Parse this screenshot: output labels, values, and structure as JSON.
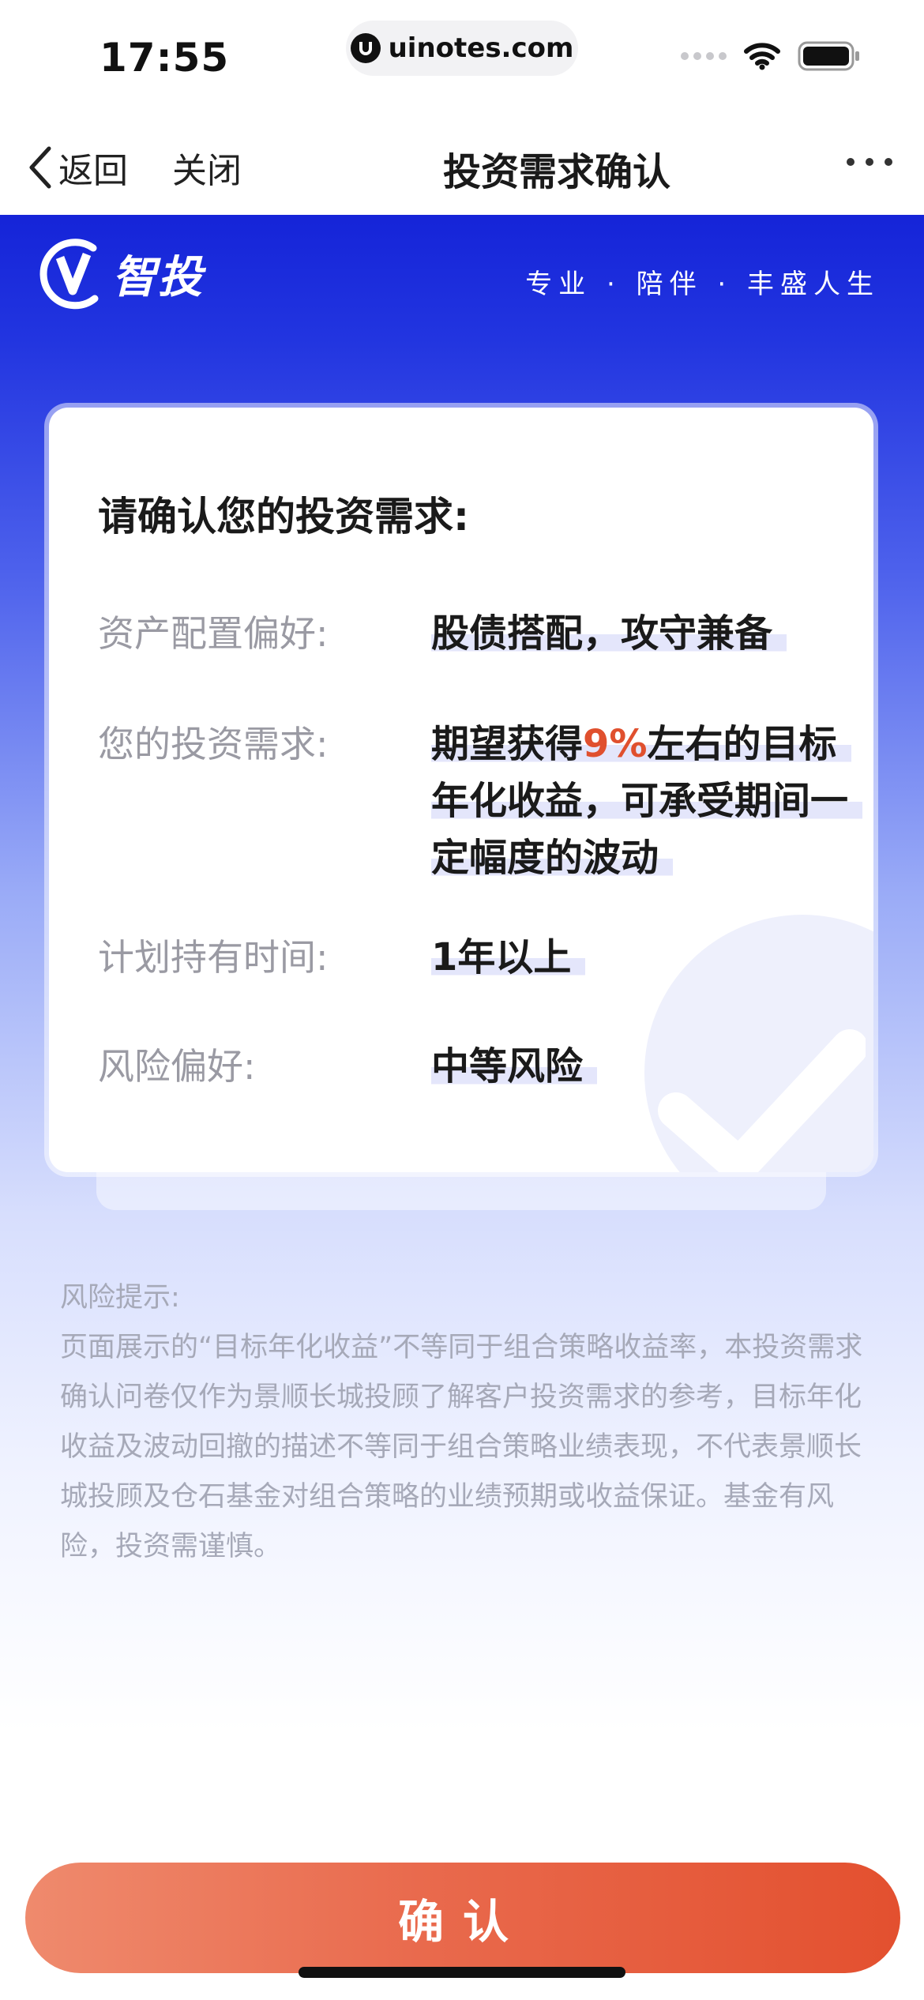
{
  "status_bar": {
    "time": "17:55",
    "url": "uinotes.com"
  },
  "nav": {
    "back_label": "返回",
    "close_label": "关闭",
    "title": "投资需求确认"
  },
  "brand": {
    "name": "智投",
    "slogan": "专业 · 陪伴 · 丰盛人生"
  },
  "card": {
    "heading": "请确认您的投资需求:",
    "rows": [
      {
        "label": "资产配置偏好:",
        "value": "股债搭配，攻守兼备"
      },
      {
        "label": "您的投资需求:",
        "value_prefix": "期望获得",
        "value_highlight": "9%",
        "value_suffix": "左右的目标年化收益，可承受期间一定幅度的波动"
      },
      {
        "label": "计划持有时间:",
        "value": "1年以上"
      },
      {
        "label": "风险偏好:",
        "value": "中等风险"
      }
    ]
  },
  "risk_notice": {
    "title": "风险提示:",
    "body": "页面展示的“目标年化收益”不等同于组合策略收益率，本投资需求确认问卷仅作为景顺长城投顾了解客户投资需求的参考，目标年化收益及波动回撤的描述不等同于组合策略业绩表现，不代表景顺长城投顾及仓石基金对组合策略的业绩预期或收益保证。基金有风险，投资需谨慎。"
  },
  "confirm_button": {
    "label": "确认"
  },
  "colors": {
    "brand_blue": "#1524d8",
    "accent_orange": "#e0502e",
    "highlight": "#e4e6fb"
  }
}
